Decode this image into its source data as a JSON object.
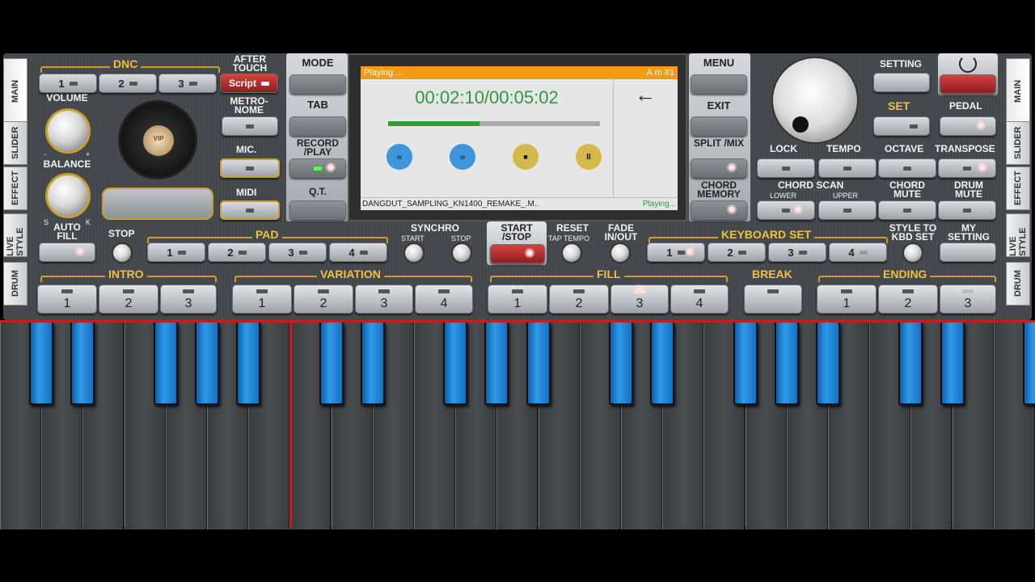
{
  "tabs_left": [
    "MAIN",
    "SLIDER",
    "EFFECT",
    "LIVE STYLE",
    "DRUM"
  ],
  "tabs_right": [
    "MAIN",
    "SLIDER",
    "EFFECT",
    "LIVE STYLE",
    "DRUM"
  ],
  "dnc": {
    "label": "DNC",
    "buttons": [
      "1",
      "2",
      "3"
    ],
    "script": "Script"
  },
  "after_touch": "AFTER TOUCH",
  "metronome": "METRO-NOME",
  "mic": "MIC.",
  "midi": "MIDI",
  "volume": "VOLUME",
  "balance": "BALANCE",
  "balance_s": "S",
  "balance_k": "K",
  "vol_minus": "-",
  "vol_plus": "+",
  "vip_label": "VIP",
  "mode": "MODE",
  "tab": "TAB",
  "record_play": "RECORD /PLAY",
  "qt": "Q.T.",
  "menu": "MENU",
  "exit": "EXIT",
  "split_mix": "SPLIT /MIX",
  "chord_memory": "CHORD MEMORY",
  "screen": {
    "status": "Playing ...",
    "chord": "A m #1",
    "time": "00:02:10/00:05:02",
    "progress": 0.43,
    "file": "DANGDUT_SAMPLING_KN1400_REMAKE_.M..",
    "state": "Playing...",
    "back": "←",
    "rew": "«",
    "ffw": "»",
    "stop": "■",
    "pause": "II"
  },
  "setting": "SETTING",
  "set": "SET",
  "pedal": "PEDAL",
  "lock": "LOCK",
  "tempo": "TEMPO",
  "octave": "OCTAVE",
  "transpose": "TRANSPOSE",
  "chord_scan": "CHORD SCAN",
  "lower": "LOWER",
  "upper": "UPPER",
  "chord_mute": "CHORD MUTE",
  "drum_mute": "DRUM MUTE",
  "auto_fill": "AUTO FILL",
  "stop": "STOP",
  "pad": {
    "label": "PAD",
    "buttons": [
      "1",
      "2",
      "3",
      "4"
    ]
  },
  "synchro": "SYNCHRO",
  "sync_start": "START",
  "sync_stop": "STOP",
  "start_stop": "START /STOP",
  "reset": "RESET",
  "tap_tempo": "TAP TEMPO",
  "fade": "FADE IN/OUT",
  "keyboard_set": {
    "label": "KEYBOARD SET",
    "buttons": [
      "1",
      "2",
      "3",
      "4"
    ]
  },
  "style_to_kbd": "STYLE TO KBD SET",
  "my_setting": "MY SETTING",
  "intro": {
    "label": "INTRO",
    "buttons": [
      "1",
      "2",
      "3"
    ]
  },
  "variation": {
    "label": "VARIATION",
    "buttons": [
      "1",
      "2",
      "3",
      "4"
    ]
  },
  "fill": {
    "label": "FILL",
    "buttons": [
      "1",
      "2",
      "3",
      "4"
    ]
  },
  "break": "BREAK",
  "ending": {
    "label": "ENDING",
    "buttons": [
      "1",
      "2",
      "3"
    ]
  },
  "colors": {
    "accent": "#c9a030",
    "blue_key": "#2f9ae8",
    "orange_bar": "#f59a14",
    "green_time": "#2f9a3c",
    "red": "#c41e1e"
  }
}
